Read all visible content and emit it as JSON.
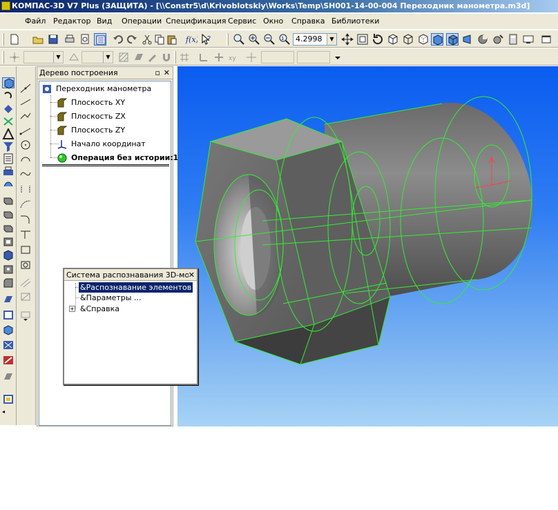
{
  "window": {
    "title": "КОМПАС-3D V7 Plus (ЗАЩИТА) - [\\\\Constr5\\d\\Krivoblotskiy\\Works\\Temp\\SH001-14-00-004 Переходник манометра.m3d]"
  },
  "menu": [
    "Файл",
    "Редактор",
    "Вид",
    "Операции",
    "Спецификация",
    "Сервис",
    "Окно",
    "Справка",
    "Библиотеки"
  ],
  "toolbar": {
    "zoom_value": "4.2998"
  },
  "tree_panel": {
    "title": "Дерево построения",
    "pin_glyph": "▫",
    "close_glyph": "✕",
    "nodes": [
      {
        "label": "Переходник манометра",
        "icon": "part-icon"
      },
      {
        "label": "Плоскость XY",
        "icon": "plane-icon"
      },
      {
        "label": "Плоскость ZX",
        "icon": "plane-icon"
      },
      {
        "label": "Плоскость ZY",
        "icon": "plane-icon"
      },
      {
        "label": "Начало координат",
        "icon": "origin-icon"
      },
      {
        "label": "Операция без истории:1",
        "icon": "operation-icon"
      }
    ]
  },
  "popup": {
    "title": "Система распознавания 3D-мо",
    "close_glyph": "✕",
    "items": [
      {
        "label": "&Распознавание элементов",
        "selected": true
      },
      {
        "label": "&Параметры ...",
        "selected": false
      },
      {
        "label": "&Справка",
        "selected": false,
        "expandable": true
      }
    ],
    "expand_glyph": "+"
  },
  "colors": {
    "edge": "#33ee33",
    "viewport_top": "#0a5cf0",
    "viewport_bottom": "#a7d3f5",
    "selection": "#0a246a"
  }
}
